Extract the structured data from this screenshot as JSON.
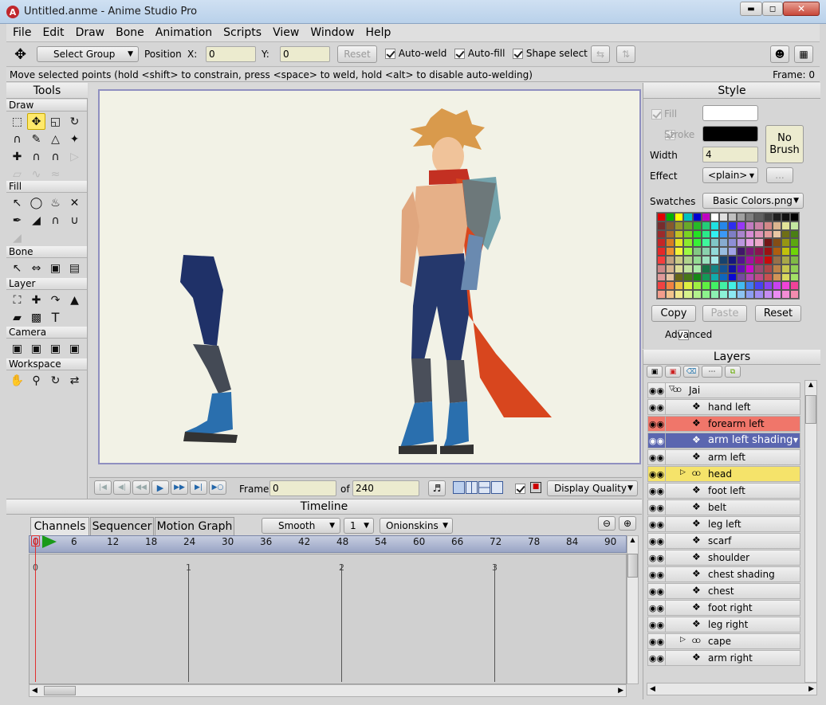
{
  "window": {
    "title": "Untitled.anme - Anime Studio Pro"
  },
  "menu": [
    "File",
    "Edit",
    "Draw",
    "Bone",
    "Animation",
    "Scripts",
    "View",
    "Window",
    "Help"
  ],
  "toolbar": {
    "select_group": "Select Group",
    "position_label": "Position",
    "x_label": "X:",
    "x_value": "0",
    "y_label": "Y:",
    "y_value": "0",
    "reset": "Reset",
    "auto_weld": "Auto-weld",
    "auto_fill": "Auto-fill",
    "shape_select": "Shape select"
  },
  "status": {
    "message": "Move selected points (hold <shift> to constrain, press <space> to weld, hold <alt> to disable auto-welding)",
    "frame": "Frame: 0"
  },
  "tools": {
    "title": "Tools",
    "sections": [
      "Draw",
      "Fill",
      "Bone",
      "Layer",
      "Camera",
      "Workspace"
    ]
  },
  "playback": {
    "frame_label": "Frame",
    "frame_value": "0",
    "of_label": "of",
    "of_value": "240",
    "display_quality": "Display Quality"
  },
  "timeline": {
    "title": "Timeline",
    "tabs": [
      "Channels",
      "Sequencer",
      "Motion Graph"
    ],
    "interp": "Smooth",
    "step": "1",
    "onionskins": "Onionskins",
    "ruler": [
      "0",
      "6",
      "12",
      "18",
      "24",
      "30",
      "36",
      "42",
      "48",
      "54",
      "60",
      "66",
      "72",
      "78",
      "84",
      "90"
    ],
    "seconds": [
      "0",
      "1",
      "2",
      "3"
    ]
  },
  "style": {
    "title": "Style",
    "fill": "Fill",
    "stroke": "Stroke",
    "width_label": "Width",
    "width_value": "4",
    "effect_label": "Effect",
    "effect_value": "<plain>",
    "effect_more": "...",
    "no_brush": "No Brush",
    "swatches_label": "Swatches",
    "swatches_value": "Basic Colors.png",
    "copy": "Copy",
    "paste": "Paste",
    "reset": "Reset",
    "advanced": "Advanced",
    "fill_color": "#ffffff",
    "stroke_color": "#000000"
  },
  "layers": {
    "title": "Layers",
    "items": [
      {
        "name": "Jai",
        "type": "bone",
        "state": "normal",
        "expand": "open"
      },
      {
        "name": "hand left",
        "type": "vector",
        "state": "normal"
      },
      {
        "name": "forearm left",
        "type": "vector",
        "state": "red"
      },
      {
        "name": "arm left shading",
        "type": "vector",
        "state": "selected"
      },
      {
        "name": "arm left",
        "type": "vector",
        "state": "normal"
      },
      {
        "name": "head",
        "type": "bone",
        "state": "yellow",
        "expand": "closed"
      },
      {
        "name": "foot left",
        "type": "vector",
        "state": "normal"
      },
      {
        "name": "belt",
        "type": "vector",
        "state": "normal"
      },
      {
        "name": "leg left",
        "type": "vector",
        "state": "normal"
      },
      {
        "name": "scarf",
        "type": "vector",
        "state": "normal"
      },
      {
        "name": "shoulder",
        "type": "vector",
        "state": "normal"
      },
      {
        "name": "chest shading",
        "type": "vector",
        "state": "normal"
      },
      {
        "name": "chest",
        "type": "vector",
        "state": "normal"
      },
      {
        "name": "foot right",
        "type": "vector",
        "state": "normal"
      },
      {
        "name": "leg right",
        "type": "vector",
        "state": "normal"
      },
      {
        "name": "cape",
        "type": "bone",
        "state": "normal",
        "expand": "closed"
      },
      {
        "name": "arm right",
        "type": "vector",
        "state": "normal"
      }
    ]
  }
}
